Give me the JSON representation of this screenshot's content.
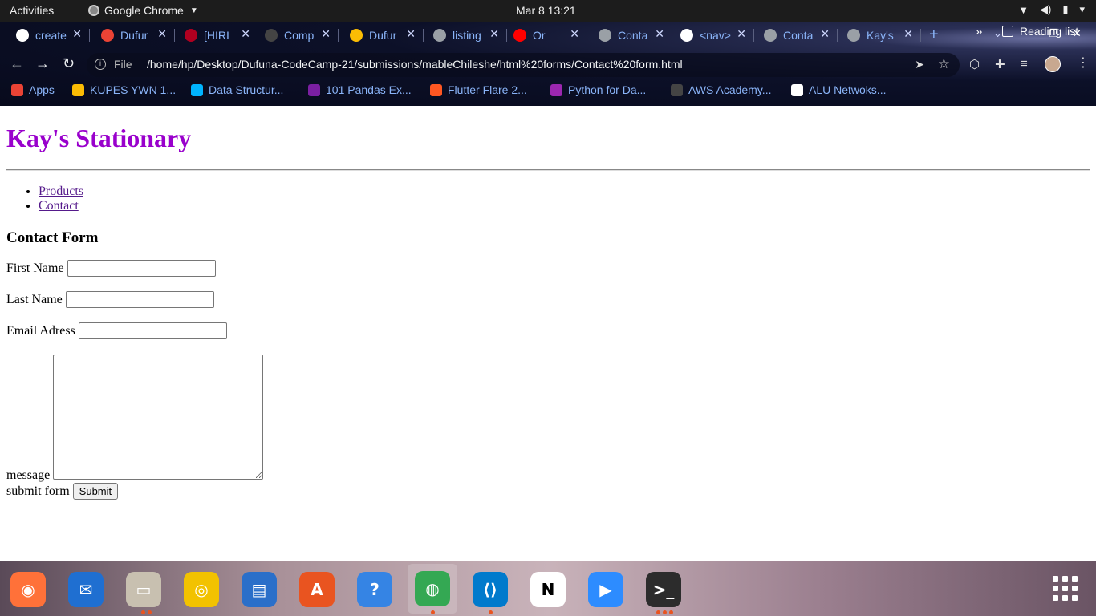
{
  "topbar": {
    "activities": "Activities",
    "app_name": "Google Chrome",
    "clock": "Mar 8  13:21"
  },
  "tabs": [
    {
      "title": "create",
      "icon_color": "#ffffff"
    },
    {
      "title": "Dufur",
      "icon_color": "#ea4335"
    },
    {
      "title": "[HIRI",
      "icon_color": "#b00020"
    },
    {
      "title": "Comp",
      "icon_color": "#444444"
    },
    {
      "title": "Dufur",
      "icon_color": "#fbbc04"
    },
    {
      "title": "listing",
      "icon_color": "#9aa0a6"
    },
    {
      "title": "Or",
      "icon_color": "#ff0000"
    },
    {
      "title": "Conta",
      "icon_color": "#9aa0a6"
    },
    {
      "title": "<nav>",
      "icon_color": "#ffffff"
    },
    {
      "title": "Conta",
      "icon_color": "#9aa0a6"
    },
    {
      "title": "Kay's",
      "icon_color": "#9aa0a6"
    }
  ],
  "toolbar": {
    "file_label": "File",
    "url": "/home/hp/Desktop/Dufuna-CodeCamp-21/submissions/mableChileshe/html%20forms/Contact%20form.html"
  },
  "bookmarks": [
    {
      "label": "Apps",
      "icon_color": "#ea4335"
    },
    {
      "label": "KUPES YWN 1...",
      "icon_color": "#fbbc04"
    },
    {
      "label": "Data Structur...",
      "icon_color": "#00b4ff"
    },
    {
      "label": "101 Pandas Ex...",
      "icon_color": "#7b1fa2"
    },
    {
      "label": "Flutter Flare 2...",
      "icon_color": "#ff5722"
    },
    {
      "label": "Python for Da...",
      "icon_color": "#9c27b0"
    },
    {
      "label": "AWS Academy...",
      "icon_color": "#444444"
    },
    {
      "label": "ALU Netwoks...",
      "icon_color": "#ffffff"
    }
  ],
  "reading_list": "Reading list",
  "page": {
    "title": "Kay's Stationary",
    "nav": [
      "Products",
      "Contact"
    ],
    "form_heading": "Contact Form",
    "first_name_label": "First Name",
    "last_name_label": "Last Name",
    "email_label": "Email Adress",
    "message_label": "message",
    "submit_row_label": "submit form",
    "submit_button": "Submit"
  },
  "dock": [
    {
      "name": "firefox-icon",
      "color": "#ff7139"
    },
    {
      "name": "thunderbird-icon",
      "color": "#1f6fd1"
    },
    {
      "name": "files-icon",
      "color": "#c8c0b0"
    },
    {
      "name": "rhythmbox-icon",
      "color": "#f2c200"
    },
    {
      "name": "libreoffice-writer-icon",
      "color": "#2a6fc9"
    },
    {
      "name": "ubuntu-software-icon",
      "color": "#e95420"
    },
    {
      "name": "help-icon",
      "color": "#3584e4"
    },
    {
      "name": "chrome-icon",
      "color": "#34a853"
    },
    {
      "name": "vscode-icon",
      "color": "#007acc"
    },
    {
      "name": "notion-icon",
      "color": "#ffffff"
    },
    {
      "name": "zoom-icon",
      "color": "#2d8cff"
    },
    {
      "name": "terminal-icon",
      "color": "#2c2c2c"
    }
  ]
}
